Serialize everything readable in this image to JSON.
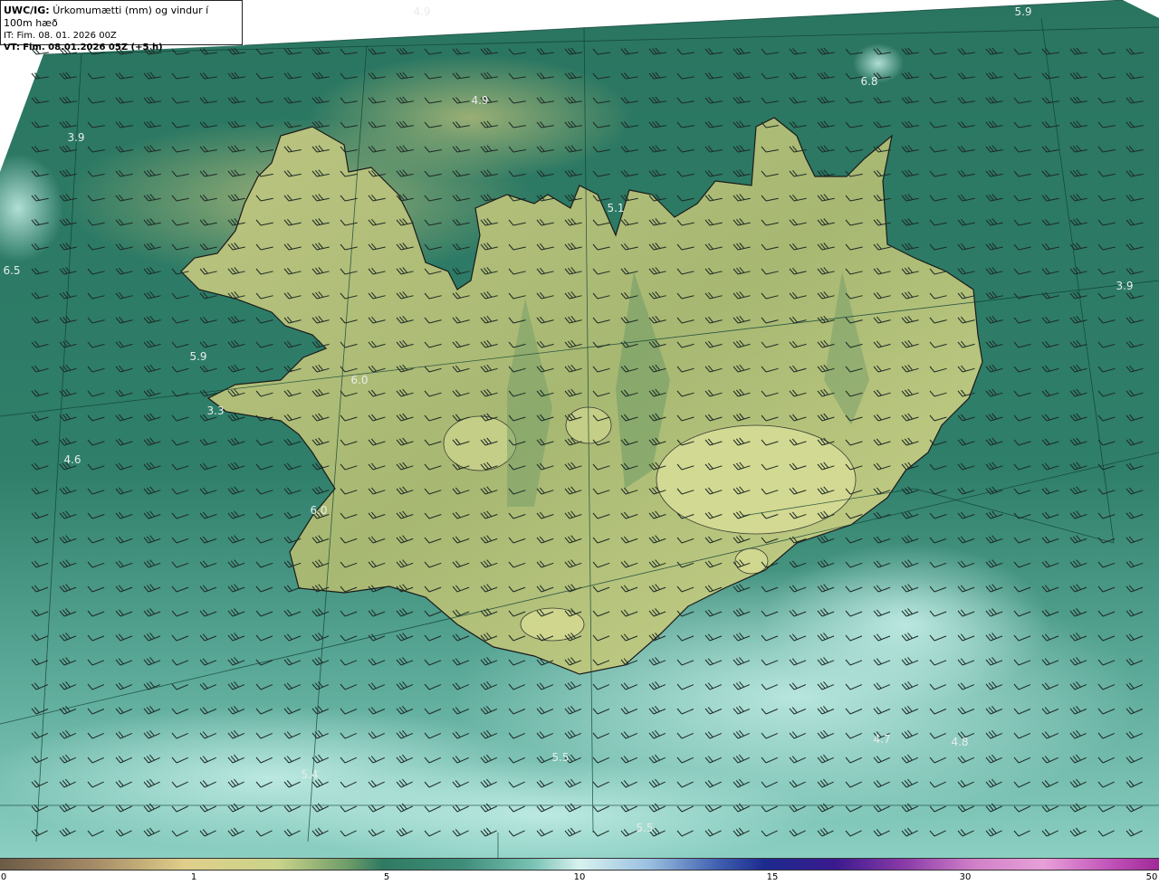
{
  "info_box": {
    "product": "UWC/IG:",
    "title": "Úrkomumætti (mm) og vindur í 100m hæð",
    "init_time": "IT: Fim. 08. 01. 2026 00Z",
    "valid_prefix": "VT:",
    "valid_time": "Fim. 08.01.2026 05Z (+5 h)"
  },
  "colors": {
    "sea_dark": "#1f6a58",
    "sea_mid": "#3a8a76",
    "sea_light": "#8fd3c6",
    "land_yellow": "#cfd68a",
    "land_green": "#7ea86a",
    "coastline": "#1a1a1a",
    "barb": "#1e2a26"
  },
  "value_labels": [
    {
      "text": "4.9"
    },
    {
      "text": "5.9"
    },
    {
      "text": "6.8"
    },
    {
      "text": "4.9"
    },
    {
      "text": "3.9"
    },
    {
      "text": "6.5"
    },
    {
      "text": "3.9"
    },
    {
      "text": "5.9"
    },
    {
      "text": "6.0"
    },
    {
      "text": "3.3"
    },
    {
      "text": "4.6"
    },
    {
      "text": "6.0"
    },
    {
      "text": "4.7"
    },
    {
      "text": "4.8"
    },
    {
      "text": "5.5"
    },
    {
      "text": "5.4"
    },
    {
      "text": "5.5"
    },
    {
      "text": "5.1"
    }
  ],
  "legend": {
    "ticks": [
      "0",
      "1",
      "5",
      "10",
      "15",
      "30",
      "50"
    ]
  }
}
